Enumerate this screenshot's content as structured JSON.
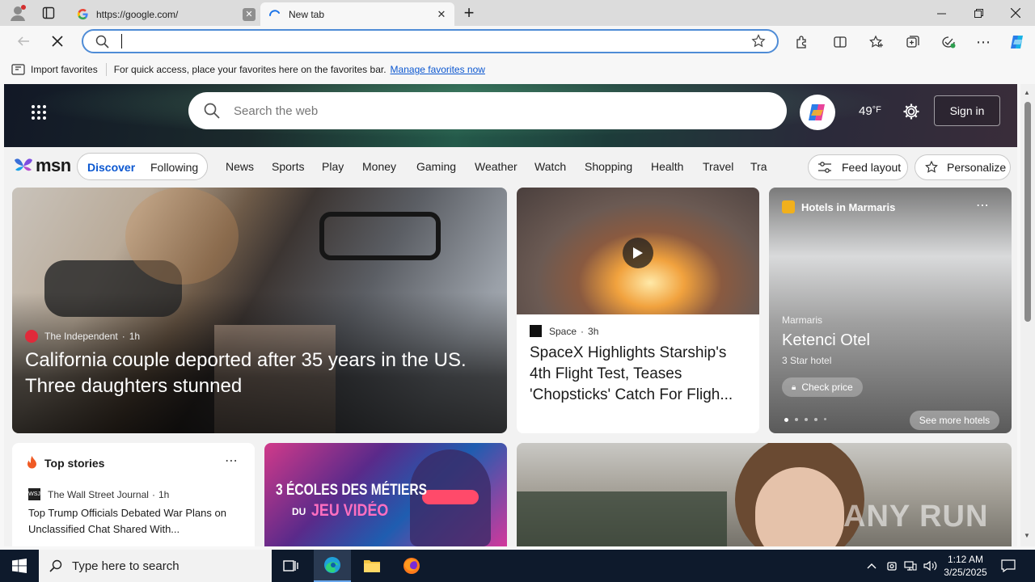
{
  "browser": {
    "tabs": [
      {
        "title": "https://google.com/"
      },
      {
        "title": "New tab"
      }
    ],
    "new_tab_symbol": "+",
    "address_value": ""
  },
  "favorites_bar": {
    "import_label": "Import favorites",
    "hint": "For quick access, place your favorites here on the favorites bar.",
    "manage_link": "Manage favorites now"
  },
  "msn": {
    "search_placeholder": "Search the web",
    "temperature": "49",
    "temp_unit": "°F",
    "sign_in": "Sign in",
    "logo_text": "msn",
    "feed_tabs": [
      "Discover",
      "Following"
    ],
    "nav_links": [
      "News",
      "Sports",
      "Play",
      "Money",
      "Gaming",
      "Weather",
      "Watch",
      "Shopping",
      "Health",
      "Travel",
      "Tra"
    ],
    "feed_layout": "Feed layout",
    "personalize": "Personalize"
  },
  "main_story": {
    "source": "The Independent",
    "age": "1h",
    "headline": "California couple deported after 35 years in the US. Three daughters stunned"
  },
  "space_story": {
    "source": "Space",
    "age": "3h",
    "headline": "SpaceX Highlights Starship's 4th Flight Test, Teases 'Chopsticks' Catch For Fligh..."
  },
  "hotel_card": {
    "title": "Hotels in Marmaris",
    "location": "Marmaris",
    "name": "Ketenci Otel",
    "stars": "3 Star hotel",
    "check_price": "Check price",
    "see_more": "See more hotels"
  },
  "top_stories": {
    "title": "Top stories",
    "source": "The Wall Street Journal",
    "age": "1h",
    "headline": "Top Trump Officials Debated War Plans on Unclassified Chat Shared With..."
  },
  "game_ad": {
    "line1": "3 ÉCOLES DES MÉTIERS",
    "line2": "DU",
    "line3": "JEU VIDÉO"
  },
  "watermark": "ANY RUN",
  "taskbar": {
    "search_placeholder": "Type here to search",
    "time": "1:12 AM",
    "date": "3/25/2025"
  }
}
